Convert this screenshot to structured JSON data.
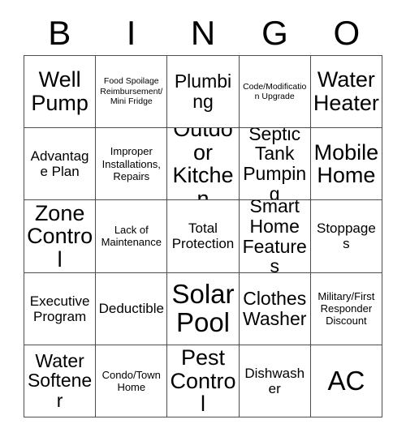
{
  "card": {
    "title": "BINGO",
    "header_letters": [
      "B",
      "I",
      "N",
      "G",
      "O"
    ],
    "columns": 5,
    "rows": 5,
    "border_color": "#4d4d4d",
    "background_color": "#ffffff",
    "text_color": "#000000",
    "cells": [
      {
        "text": "Well Pump",
        "size": "xl",
        "row": 1,
        "col": 1
      },
      {
        "text": "Food Spoilage Reimbursement/ Mini Fridge",
        "size": "xs",
        "row": 1,
        "col": 2
      },
      {
        "text": "Plumbing",
        "size": "lg",
        "row": 1,
        "col": 3
      },
      {
        "text": "Code/Modification Upgrade",
        "size": "xs",
        "row": 1,
        "col": 4
      },
      {
        "text": "Water Heater",
        "size": "xl",
        "row": 1,
        "col": 5
      },
      {
        "text": "Advantage Plan",
        "size": "md",
        "row": 2,
        "col": 1
      },
      {
        "text": "Improper Installations, Repairs",
        "size": "sm",
        "row": 2,
        "col": 2
      },
      {
        "text": "Outdoor Kitchen",
        "size": "xl",
        "row": 2,
        "col": 3
      },
      {
        "text": "Septic Tank Pumping",
        "size": "lg",
        "row": 2,
        "col": 4
      },
      {
        "text": "Mobile Home",
        "size": "xl",
        "row": 2,
        "col": 5
      },
      {
        "text": "Zone Control",
        "size": "xl",
        "row": 3,
        "col": 1
      },
      {
        "text": "Lack of Maintenance",
        "size": "sm",
        "row": 3,
        "col": 2
      },
      {
        "text": "Total Protection",
        "size": "md",
        "row": 3,
        "col": 3
      },
      {
        "text": "Smart Home Features",
        "size": "lg",
        "row": 3,
        "col": 4
      },
      {
        "text": "Stoppages",
        "size": "md",
        "row": 3,
        "col": 5
      },
      {
        "text": "Executive Program",
        "size": "md",
        "row": 4,
        "col": 1
      },
      {
        "text": "Deductible",
        "size": "md",
        "row": 4,
        "col": 2
      },
      {
        "text": "Solar Pool",
        "size": "xxl",
        "row": 4,
        "col": 3
      },
      {
        "text": "Clothes Washer",
        "size": "lg",
        "row": 4,
        "col": 4
      },
      {
        "text": "Military/First Responder Discount",
        "size": "sm",
        "row": 4,
        "col": 5
      },
      {
        "text": "Water Softener",
        "size": "lg",
        "row": 5,
        "col": 1
      },
      {
        "text": "Condo/Town Home",
        "size": "sm",
        "row": 5,
        "col": 2
      },
      {
        "text": "Pest Control",
        "size": "xl",
        "row": 5,
        "col": 3
      },
      {
        "text": "Dishwasher",
        "size": "md",
        "row": 5,
        "col": 4
      },
      {
        "text": "AC",
        "size": "xxl",
        "row": 5,
        "col": 5
      }
    ]
  }
}
